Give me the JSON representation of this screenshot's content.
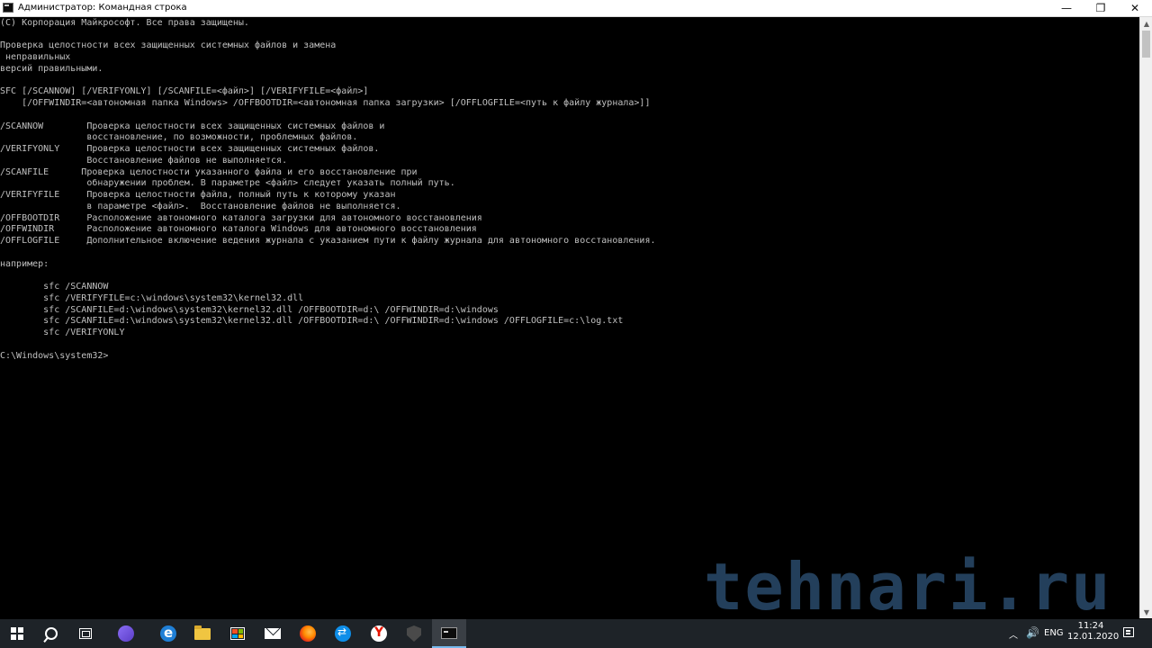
{
  "window": {
    "title": "Администратор: Командная строка",
    "minimize_glyph": "—",
    "maximize_glyph": "❐",
    "close_glyph": "✕"
  },
  "console_lines": [
    "(C) Корпорация Майкрософт. Все права защищены.",
    "",
    "Проверка целостности всех защищенных системных файлов и замена",
    " неправильных",
    "версий правильными.",
    "",
    "SFC [/SCANNOW] [/VERIFYONLY] [/SCANFILE=<файл>] [/VERIFYFILE=<файл>]",
    "    [/OFFWINDIR=<автономная папка Windows> /OFFBOOTDIR=<автономная папка загрузки> [/OFFLOGFILE=<путь к файлу журнала>]]",
    "",
    "/SCANNOW        Проверка целостности всех защищенных системных файлов и",
    "                восстановление, по возможности, проблемных файлов.",
    "/VERIFYONLY     Проверка целостности всех защищенных системных файлов.",
    "                Восстановление файлов не выполняется.",
    "/SCANFILE      Проверка целостности указанного файла и его восстановление при",
    "                обнаружении проблем. В параметре <файл> следует указать полный путь.",
    "/VERIFYFILE     Проверка целостности файла, полный путь к которому указан",
    "                в параметре <файл>.  Восстановление файлов не выполняется.",
    "/OFFBOOTDIR     Расположение автономного каталога загрузки для автономного восстановления",
    "/OFFWINDIR      Расположение автономного каталога Windows для автономного восстановления",
    "/OFFLOGFILE     Дополнительное включение ведения журнала с указанием пути к файлу журнала для автономного восстановления.",
    "",
    "например:",
    "",
    "        sfc /SCANNOW",
    "        sfc /VERIFYFILE=c:\\windows\\system32\\kernel32.dll",
    "        sfc /SCANFILE=d:\\windows\\system32\\kernel32.dll /OFFBOOTDIR=d:\\ /OFFWINDIR=d:\\windows",
    "        sfc /SCANFILE=d:\\windows\\system32\\kernel32.dll /OFFBOOTDIR=d:\\ /OFFWINDIR=d:\\windows /OFFLOGFILE=c:\\log.txt",
    "        sfc /VERIFYONLY",
    "",
    "C:\\Windows\\system32>"
  ],
  "watermark": "tehnari.ru",
  "taskbar": {
    "apps": [
      "start-icon",
      "search-icon",
      "task-view-icon",
      "cortana-icon",
      "edge-icon",
      "file-explorer-icon",
      "store-icon",
      "mail-icon",
      "firefox-icon",
      "teamviewer-icon",
      "yandex-browser-icon",
      "world-of-tanks-icon",
      "command-prompt-icon"
    ],
    "active_app": "command-prompt-icon",
    "tray": {
      "language": "ENG",
      "time": "11:24",
      "date": "12.01.2020"
    }
  },
  "colors": {
    "console_background": "#000000",
    "console_text": "#c0c0c0",
    "taskbar": "#1e2328",
    "watermark": "#2a4a6b"
  }
}
